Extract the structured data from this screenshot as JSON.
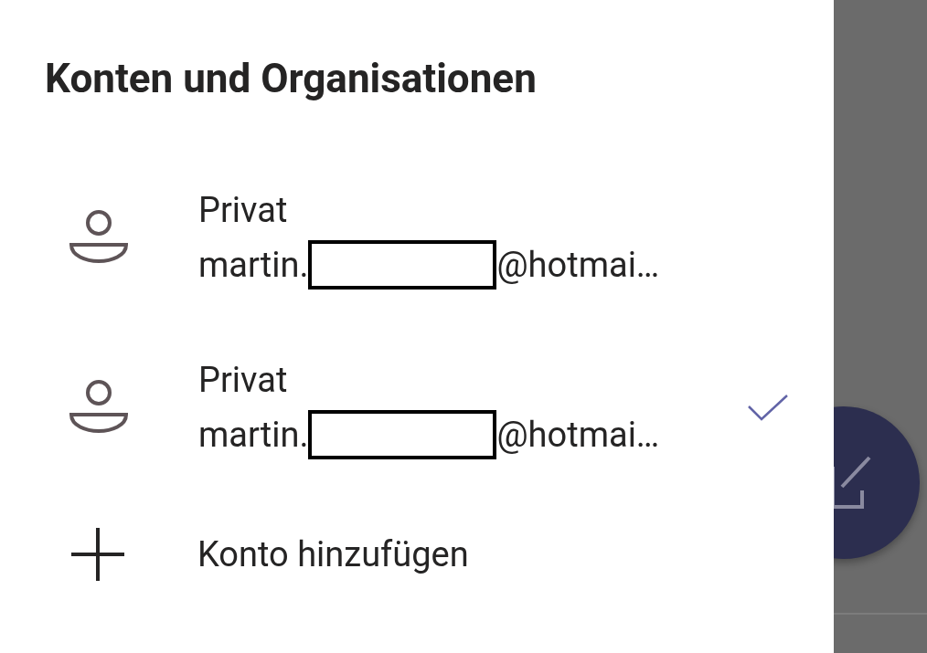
{
  "drawer": {
    "title": "Konten und Organisationen",
    "accounts": [
      {
        "label": "Privat",
        "email_start": "martin.",
        "email_end": "@hotmai…",
        "selected": false
      },
      {
        "label": "Privat",
        "email_start": "martin.",
        "email_end": "@hotmai…",
        "selected": true
      }
    ],
    "add_account": "Konto hinzufügen"
  }
}
